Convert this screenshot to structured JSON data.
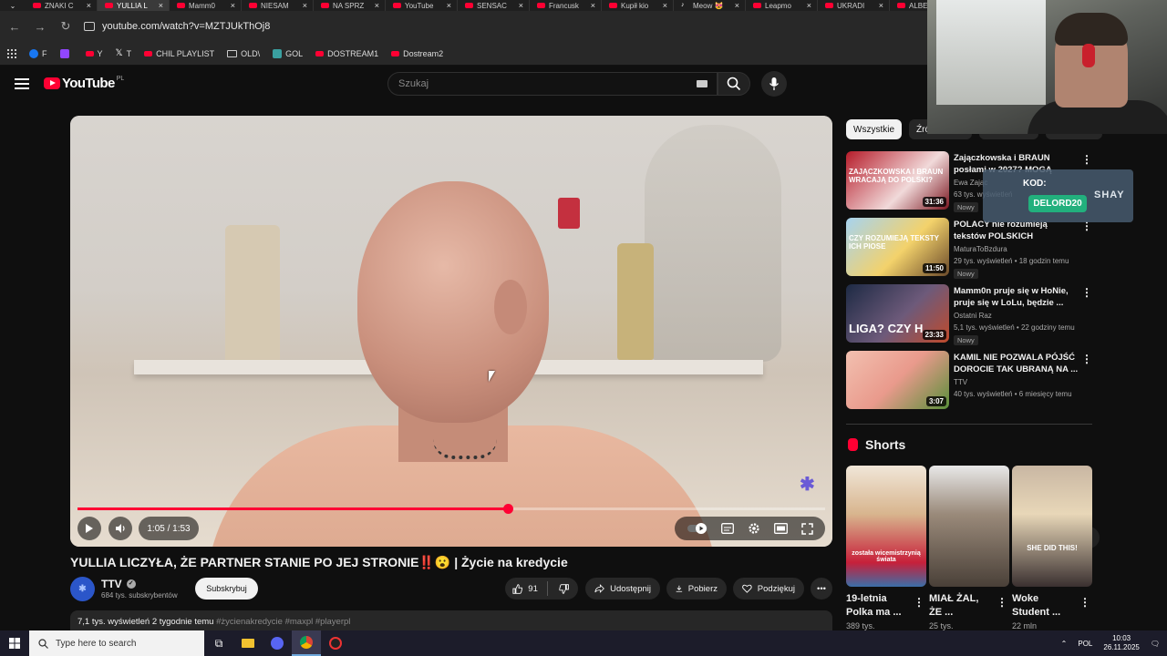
{
  "browser": {
    "tabs": [
      {
        "label": "ZNAKI C",
        "icon": "youtube-icon",
        "active": false
      },
      {
        "label": "YULLIA L",
        "icon": "youtube-icon",
        "active": true
      },
      {
        "label": "Mamm0",
        "icon": "youtube-icon",
        "active": false
      },
      {
        "label": "NIESAM",
        "icon": "youtube-icon",
        "active": false
      },
      {
        "label": "NA SPRZ",
        "icon": "youtube-icon",
        "active": false
      },
      {
        "label": "YouTube",
        "icon": "youtube-icon",
        "active": false
      },
      {
        "label": "SENSAC",
        "icon": "youtube-icon",
        "active": false
      },
      {
        "label": "Francusk",
        "icon": "youtube-icon",
        "active": false
      },
      {
        "label": "Kupił kio",
        "icon": "youtube-icon",
        "active": false
      },
      {
        "label": "Meow 😻",
        "icon": "tiktok-icon",
        "active": false
      },
      {
        "label": "Leapmo",
        "icon": "youtube-icon",
        "active": false
      },
      {
        "label": "UKRADI",
        "icon": "youtube-icon",
        "active": false
      },
      {
        "label": "ALBE",
        "icon": "youtube-icon",
        "active": false
      }
    ],
    "url": "youtube.com/watch?v=MZTJUkThOj8",
    "bookmarks": [
      {
        "label": "F",
        "icon": "facebook-icon"
      },
      {
        "label": "",
        "icon": "twitch-icon"
      },
      {
        "label": "Y",
        "icon": "youtube-icon"
      },
      {
        "label": "T",
        "icon": "x-icon"
      },
      {
        "label": "CHIL PLAYLIST",
        "icon": "youtube-icon"
      },
      {
        "label": "OLD\\",
        "icon": "folder-icon"
      },
      {
        "label": "GOL",
        "icon": "green-icon"
      },
      {
        "label": "DOSTREAM1",
        "icon": "youtube-icon"
      },
      {
        "label": "Dostream2",
        "icon": "youtube-icon"
      }
    ]
  },
  "youtube": {
    "logo_text": "YouTube",
    "country_code": "PL",
    "search_placeholder": "Szukaj"
  },
  "player": {
    "current_time": "1:05",
    "duration": "1:53",
    "time_display": "1:05 / 1:53",
    "progress": 0.575
  },
  "video": {
    "title": "YULLIA LICZYŁA, ŻE PARTNER STANIE PO JEJ STRONIE‼️😮 | Życie na kredycie",
    "channel": "TTV",
    "subscribers": "684 tys. subskrybentów",
    "subscribe_label": "Subskrybuj",
    "likes": "91",
    "share_label": "Udostępnij",
    "download_label": "Pobierz",
    "thanks_label": "Podziękuj",
    "views_date": "7,1 tys. wyświetleń  2 tygodnie temu",
    "hashtags": "#życienakredycie #maxpl #playerpl"
  },
  "chips": [
    "Wszystkie",
    "Źródło: TTV",
    "Powiązane",
    "Dla Ciebie"
  ],
  "recommendations": [
    {
      "title": "Zajączkowska i BRAUN posłami w 2027? MOGĄ ROZMOWA",
      "channel": "Ewa Zając",
      "meta": "63 tys. wyświetleń",
      "badge": "Nowy",
      "duration": "31:36"
    },
    {
      "title": "POLACY nie rozumieją tekstów POLSKICH PIOSENEK?!",
      "channel": "MaturaToBzdura",
      "meta": "29 tys. wyświetleń • 18 godzin temu",
      "badge": "Nowy",
      "duration": "11:50"
    },
    {
      "title": "Mamm0n pruje się w HoNie, pruje się w LoLu, będzie ...",
      "channel": "Ostatni Raz",
      "meta": "5,1 tys. wyświetleń • 22 godziny temu",
      "badge": "Nowy",
      "duration": "23:33"
    },
    {
      "title": "KAMIL NIE POZWALA PÓJŚĆ DOROCIE TAK UBRANĄ NA ...",
      "channel": "TTV",
      "meta": "40 tys. wyświetleń • 6 miesięcy temu",
      "badge": "",
      "duration": "3:07"
    }
  ],
  "thumb_texts": [
    "ZAJĄCZKOWSKA I BRAUN WRACAJĄ DO POLSKI?",
    "CZY ROZUMIEJĄ TEKSTY ICH PIOSE",
    "LIGA? CZY H",
    ""
  ],
  "shorts": {
    "heading": "Shorts",
    "items": [
      {
        "title": "19-letnia Polka ma ...",
        "views": "389 tys.",
        "caption": "została wicemistrzynią świata"
      },
      {
        "title": "MIAŁ ŻAL, ŻE ...",
        "views": "25 tys.",
        "caption": ""
      },
      {
        "title": "Woke Student ...",
        "views": "22 mln",
        "caption": "SHE DID THIS!"
      }
    ]
  },
  "overlay": {
    "code_label": "KOD:",
    "code": "DELORD20",
    "brand": "SHAY"
  },
  "taskbar": {
    "search_placeholder": "Type here to search",
    "language": "POL",
    "time": "10:03",
    "date": "26.11.2025"
  }
}
